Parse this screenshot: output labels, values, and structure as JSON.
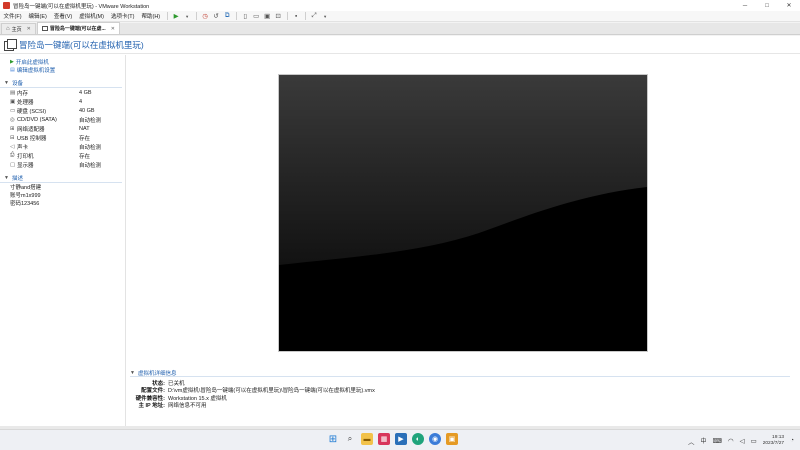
{
  "window": {
    "title": "冒险岛一键端(可以在虚拟机里玩) - VMware Workstation",
    "controls": {
      "minimize": "─",
      "maximize": "□",
      "close": "✕"
    }
  },
  "menubar": {
    "items": [
      "文件(F)",
      "编辑(E)",
      "查看(V)",
      "虚拟机(M)",
      "选项卡(T)",
      "帮助(H)"
    ]
  },
  "toolbar": {
    "icons": [
      "play-icon",
      "snapshot-icon",
      "revert-snapshot-icon",
      "snapshot-manager-icon",
      "view-icon",
      "fullscreen-icon",
      "unity-icon",
      "console-icon",
      "stretch-icon"
    ]
  },
  "tabs": [
    {
      "label": "主页",
      "icon": "home-icon",
      "active": false
    },
    {
      "label": "冒险岛一键端(可以在虚...",
      "icon": "vm-icon",
      "active": true
    }
  ],
  "vm": {
    "title": "冒险岛一键端(可以在虚拟机里玩)"
  },
  "actions": [
    {
      "label": "开启此虚拟机",
      "icon": "play-icon"
    },
    {
      "label": "编辑虚拟机设置",
      "icon": "edit-icon"
    }
  ],
  "devices": {
    "heading": "设备",
    "items": [
      {
        "name": "内存",
        "value": "4 GB",
        "icon": "memory-icon",
        "glyph": "▤"
      },
      {
        "name": "处理器",
        "value": "4",
        "icon": "cpu-icon",
        "glyph": "▣"
      },
      {
        "name": "硬盘 (SCSI)",
        "value": "40 GB",
        "icon": "disk-icon",
        "glyph": "▭"
      },
      {
        "name": "CD/DVD (SATA)",
        "value": "自动检测",
        "icon": "cd-icon",
        "glyph": "◎"
      },
      {
        "name": "网络适配器",
        "value": "NAT",
        "icon": "network-icon",
        "glyph": "⊞"
      },
      {
        "name": "USB 控制器",
        "value": "存在",
        "icon": "usb-icon",
        "glyph": "⊟"
      },
      {
        "name": "声卡",
        "value": "自动检测",
        "icon": "sound-icon",
        "glyph": "◁"
      },
      {
        "name": "打印机",
        "value": "存在",
        "icon": "printer-icon",
        "glyph": "⎙"
      },
      {
        "name": "显示器",
        "value": "自动检测",
        "icon": "display-icon",
        "glyph": "▢"
      }
    ]
  },
  "description": {
    "heading": "描述",
    "lines": [
      "寸静and搭建",
      "账号m1x999",
      "密码123456"
    ]
  },
  "details": {
    "heading": "虚拟机详细信息",
    "rows": [
      {
        "key": "状态:",
        "value": "已关机"
      },
      {
        "key": "配置文件:",
        "value": "D:\\vm虚拟机\\冒险岛一键端(可以在虚拟机里玩)\\冒险岛一键端(可以在虚拟机里玩).vmx"
      },
      {
        "key": "硬件兼容性:",
        "value": "Workstation 15.x 虚拟机"
      },
      {
        "key": "主 IP 地址:",
        "value": "网络信息不可用"
      }
    ]
  },
  "taskbar": {
    "apps": [
      "windows-start-icon",
      "search-icon",
      "file-explorer-icon",
      "store-icon",
      "media-icon",
      "edge-icon",
      "chrome-icon",
      "vmware-icon"
    ],
    "tray": {
      "ime": "中",
      "time": "19:13",
      "date": "2023/7/27"
    }
  }
}
